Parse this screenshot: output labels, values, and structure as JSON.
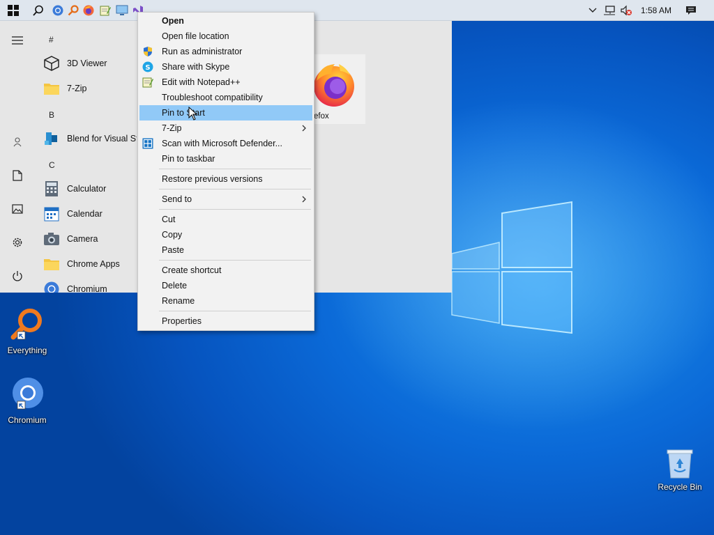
{
  "taskbar": {
    "clock": "1:58 AM",
    "icons": [
      "windows-start-icon",
      "search-icon",
      "chromium-icon",
      "everything-icon",
      "firefox-icon",
      "notepadpp-icon",
      "remote-desktop-icon",
      "visual-studio-icon"
    ],
    "tray_icons": [
      "chevron-up-icon",
      "network-icon",
      "volume-muted-icon",
      "notification-icon"
    ]
  },
  "start_menu": {
    "rail": [
      "hamburger-icon",
      "user-icon",
      "document-icon",
      "pictures-icon",
      "settings-icon",
      "power-icon"
    ],
    "groups": [
      {
        "header": "#",
        "items": [
          {
            "label": "3D Viewer",
            "icon": "cube-icon"
          },
          {
            "label": "7-Zip",
            "icon": "folder-icon"
          }
        ]
      },
      {
        "header": "B",
        "items": [
          {
            "label": "Blend for Visual Studio",
            "icon": "blend-icon"
          }
        ]
      },
      {
        "header": "C",
        "items": [
          {
            "label": "Calculator",
            "icon": "calculator-icon"
          },
          {
            "label": "Calendar",
            "icon": "calendar-icon"
          },
          {
            "label": "Camera",
            "icon": "camera-icon"
          },
          {
            "label": "Chrome Apps",
            "icon": "folder-icon"
          },
          {
            "label": "Chromium",
            "icon": "chromium-icon"
          }
        ]
      }
    ],
    "tiles": [
      {
        "label": "Firefox",
        "visible_label": "efox",
        "icon": "firefox-icon"
      }
    ]
  },
  "context_menu": {
    "items": [
      {
        "label": "Open",
        "bold": true
      },
      {
        "label": "Open file location"
      },
      {
        "label": "Run as administrator",
        "icon": "uac-shield-icon"
      },
      {
        "label": "Share with Skype",
        "icon": "skype-icon"
      },
      {
        "label": "Edit with Notepad++",
        "icon": "notepadpp-icon"
      },
      {
        "label": "Troubleshoot compatibility"
      },
      {
        "label": "Pin to Start",
        "highlighted": true
      },
      {
        "label": "7-Zip",
        "submenu": true
      },
      {
        "label": "Scan with Microsoft Defender...",
        "icon": "defender-icon"
      },
      {
        "label": "Pin to taskbar"
      },
      {
        "label": "Restore previous versions"
      },
      {
        "label": "Send to",
        "submenu": true
      },
      {
        "label": "Cut"
      },
      {
        "label": "Copy"
      },
      {
        "label": "Paste"
      },
      {
        "label": "Create shortcut"
      },
      {
        "label": "Delete"
      },
      {
        "label": "Rename"
      },
      {
        "label": "Properties"
      }
    ]
  },
  "desktop": {
    "icons": [
      {
        "label": "Everything",
        "icon": "everything-icon"
      },
      {
        "label": "Chromium",
        "icon": "chromium-icon"
      },
      {
        "label": "Recycle Bin",
        "icon": "recycle-bin-icon"
      }
    ]
  },
  "colors": {
    "taskbar_bg": "#dfe6ee",
    "menu_bg": "#f2f2f2",
    "start_bg": "#e6e6e6",
    "highlight": "#91c9f7",
    "desktop_blue": "#0b6ad8"
  }
}
